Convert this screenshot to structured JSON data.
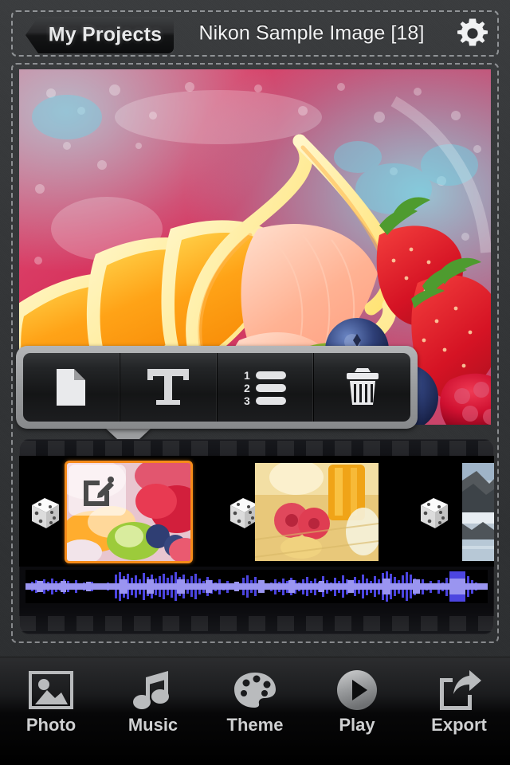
{
  "header": {
    "back_label": "My Projects",
    "title": "Nikon Sample Image [18]",
    "gear_icon": "gear-icon"
  },
  "stage": {
    "photo_description": "fruit salad with orange slices, grapefruit, kiwi, strawberries and blueberries on a pink patterned plate"
  },
  "popover": {
    "buttons": [
      {
        "icon": "page-icon",
        "name": "duplicate-slide-button"
      },
      {
        "icon": "text-icon",
        "name": "add-text-button"
      },
      {
        "icon": "numbered-list-icon",
        "name": "reorder-slides-button"
      },
      {
        "icon": "trash-icon",
        "name": "delete-slide-button"
      }
    ]
  },
  "timeline": {
    "slides": [
      {
        "name": "slide-1",
        "selected": true,
        "badge_icon": "edit-icon",
        "description": "fruit salad"
      },
      {
        "name": "slide-2",
        "selected": false,
        "description": "red gerbera flowers with glassware"
      },
      {
        "name": "slide-3",
        "selected": false,
        "description": "snowy mountain lake"
      }
    ],
    "transitions": [
      {
        "name": "transition-1",
        "icon": "dice-icon"
      },
      {
        "name": "transition-2",
        "icon": "dice-icon"
      },
      {
        "name": "transition-3",
        "icon": "dice-icon"
      }
    ],
    "audio_track": {
      "name": "audio-waveform",
      "color": "#4c45e0"
    }
  },
  "tabbar": {
    "items": [
      {
        "label": "Photo",
        "icon": "photo-icon"
      },
      {
        "label": "Music",
        "icon": "music-note-icon"
      },
      {
        "label": "Theme",
        "icon": "palette-icon"
      },
      {
        "label": "Play",
        "icon": "play-icon"
      },
      {
        "label": "Export",
        "icon": "share-icon"
      }
    ]
  },
  "colors": {
    "selection_orange": "#f58b19",
    "waveform_blue": "#4c45e0",
    "chrome_dark": "#313335",
    "popover_gray": "#9b9d9f"
  }
}
